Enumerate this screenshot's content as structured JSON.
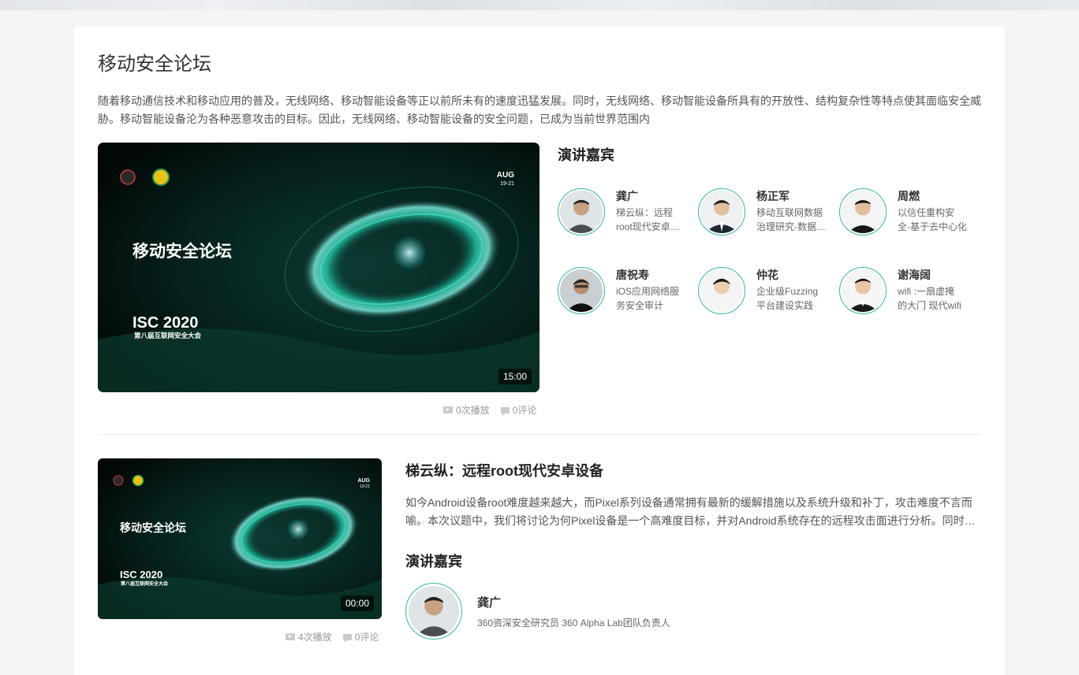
{
  "forum": {
    "title": "移动安全论坛",
    "intro": "随着移动通信技术和移动应用的普及，无线网络、移动智能设备等正以前所未有的速度迅猛发展。同时，无线网络、移动智能设备所具有的开放性、结构复杂性等特点使其面临安全威胁。移动智能设备沦为各种恶意攻击的目标。因此，无线网络、移动智能设备的安全问题，已成为当前世界范围内"
  },
  "main_video": {
    "thumb_title": "移动安全论坛",
    "thumb_event": "ISC 2020",
    "thumb_event_cn": "第八届互联网安全大会",
    "thumb_date_month": "AUG",
    "thumb_date_days": "19-21",
    "duration": "15:00",
    "plays": "0次播放",
    "comments": "0评论"
  },
  "speakers_heading": "演讲嘉宾",
  "speakers": [
    {
      "name": "龚广",
      "desc_line1": "梯云纵：远程",
      "desc_line2": "root现代安卓设备"
    },
    {
      "name": "杨正军",
      "desc_line1": "移动互联网数据",
      "desc_line2": "治理研究-数据安全"
    },
    {
      "name": "周燃",
      "desc_line1": "以信任重构安",
      "desc_line2": "全-基于去中心化"
    },
    {
      "name": "唐祝寿",
      "desc_line1": "iOS应用网络服",
      "desc_line2": "务安全审计"
    },
    {
      "name": "仲花",
      "desc_line1": "企业级Fuzzing",
      "desc_line2": "平台建设实践"
    },
    {
      "name": "谢海阔",
      "desc_line1": "wifi :一扇虚掩",
      "desc_line2": "的大门 现代wifi"
    }
  ],
  "talk": {
    "title": "梯云纵：远程root现代安卓设备",
    "desc_line1": "如今Android设备root难度越来越大，而Pixel系列设备通常拥有最新的缓解措施以及系统升级和补丁，攻击难度不言而",
    "desc_line2": "喻。本次议题中，我们将讨论为何Pixel设备是一个高难度目标，并对Android系统存在的远程攻击面进行分析。同时，我们",
    "duration": "00:00",
    "plays": "4次播放",
    "comments": "0评论",
    "speakers_heading": "演讲嘉宾",
    "speaker_name": "龚广",
    "speaker_desc": "360资深安全研究员 360 Alpha Lab团队负责人"
  }
}
